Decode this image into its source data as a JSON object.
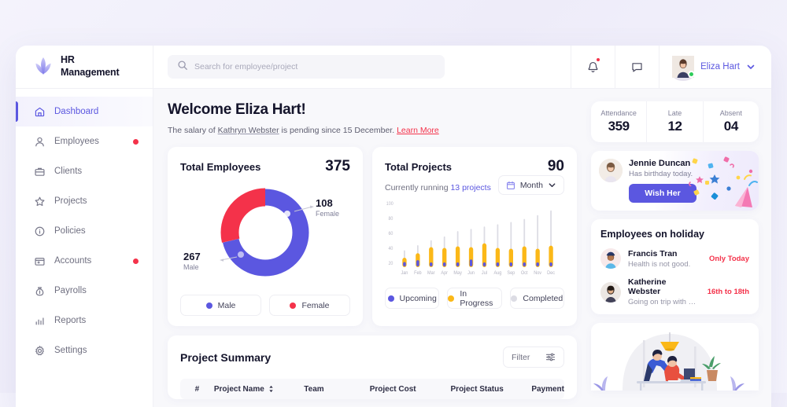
{
  "brand": {
    "line1": "HR",
    "line2": "Management",
    "logo_icon": "lotus-logo-icon"
  },
  "search": {
    "placeholder": "Search for employee/project",
    "value": "",
    "icon": "search-icon"
  },
  "header": {
    "bell_icon": "bell-icon",
    "chat_icon": "chat-bubble-icon",
    "user_name": "Eliza Hart",
    "chevron_icon": "chevron-down-icon"
  },
  "sidebar": {
    "items": [
      {
        "label": "Dashboard",
        "icon": "home-icon",
        "active": true,
        "badge": false
      },
      {
        "label": "Employees",
        "icon": "user-icon",
        "active": false,
        "badge": true
      },
      {
        "label": "Clients",
        "icon": "briefcase-icon",
        "active": false,
        "badge": false
      },
      {
        "label": "Projects",
        "icon": "star-icon",
        "active": false,
        "badge": false
      },
      {
        "label": "Policies",
        "icon": "info-icon",
        "active": false,
        "badge": false
      },
      {
        "label": "Accounts",
        "icon": "folder-icon",
        "active": false,
        "badge": true
      },
      {
        "label": "Payrolls",
        "icon": "money-bag-icon",
        "active": false,
        "badge": false
      },
      {
        "label": "Reports",
        "icon": "bar-chart-icon",
        "active": false,
        "badge": false
      },
      {
        "label": "Settings",
        "icon": "gear-icon",
        "active": false,
        "badge": false
      }
    ]
  },
  "welcome": {
    "heading": "Welcome Eliza Hart!",
    "sub_prefix": "The salary of ",
    "sub_person": "Kathryn Webster",
    "sub_middle": " is pending since 15 December. ",
    "sub_link": "Learn More"
  },
  "employees_card": {
    "title": "Total Employees",
    "total": "375",
    "male_value": "267",
    "male_label": "Male",
    "female_value": "108",
    "female_label": "Female",
    "legend": [
      {
        "label": "Male",
        "color": "#5b57e0"
      },
      {
        "label": "Female",
        "color": "#f4324a"
      }
    ]
  },
  "projects_card": {
    "title": "Total Projects",
    "total": "90",
    "sub_prefix": "Currently running ",
    "sub_link": "13 projects",
    "range_label": "Month",
    "calendar_icon": "calendar-icon",
    "chevron_icon": "chevron-down-icon",
    "legend": [
      {
        "label": "Upcoming",
        "color": "#5b57e0"
      },
      {
        "label": "In Progress",
        "color": "#fbb818"
      },
      {
        "label": "Completed",
        "color": "#dcdce4"
      }
    ]
  },
  "chart_data": [
    {
      "type": "pie",
      "title": "Total Employees",
      "labels": [
        "Male",
        "Female"
      ],
      "values": [
        267,
        108
      ],
      "colors": [
        "#5b57e0",
        "#f4324a"
      ],
      "total": 375,
      "donut": true
    },
    {
      "type": "bar",
      "title": "Total Projects",
      "stacked": true,
      "categories": [
        "Jan",
        "Feb",
        "Mar",
        "Apr",
        "May",
        "Jun",
        "Jul",
        "Aug",
        "Sep",
        "Oct",
        "Nov",
        "Dec"
      ],
      "series": [
        {
          "name": "Upcoming",
          "color": "#5b57e0",
          "values": [
            22,
            24,
            21,
            21,
            21,
            25,
            21,
            21,
            21,
            21,
            21,
            21
          ]
        },
        {
          "name": "In Progress",
          "color": "#fbb818",
          "values": [
            26,
            32,
            40,
            39,
            41,
            40,
            45,
            39,
            38,
            41,
            38,
            42
          ]
        },
        {
          "name": "Completed",
          "color": "#dcdce4",
          "values": [
            38,
            45,
            52,
            57,
            64,
            67,
            70,
            73,
            76,
            80,
            85,
            91
          ]
        }
      ],
      "ylim": [
        20,
        100
      ],
      "yticks": [
        20,
        40,
        60,
        80,
        100
      ],
      "ylabel": "",
      "xlabel": "",
      "grid": false,
      "legend_position": "bottom"
    }
  ],
  "stats": [
    {
      "label": "Attendance",
      "value": "359"
    },
    {
      "label": "Late",
      "value": "12"
    },
    {
      "label": "Absent",
      "value": "04"
    }
  ],
  "birthday": {
    "name": "Jennie Duncan",
    "note": "Has birthday today.",
    "button": "Wish Her"
  },
  "holiday": {
    "title": "Employees on holiday",
    "items": [
      {
        "name": "Francis Tran",
        "note": "Health is not good.",
        "when": "Only Today"
      },
      {
        "name": "Katherine Webster",
        "note": "Going on trip with my fam…",
        "when": "16th to 18th"
      }
    ]
  },
  "summary": {
    "title": "Project Summary",
    "filter_label": "Filter",
    "filter_icon": "sliders-icon",
    "columns": [
      "#",
      "Project Name",
      "Team",
      "Project Cost",
      "Project Status",
      "Payment"
    ],
    "sort_icon": "sort-arrows-icon"
  },
  "colors": {
    "accent": "#5b57e0",
    "danger": "#f4324a",
    "warning": "#fbb818",
    "muted": "#dcdce4",
    "page_bg": "#f2f1fb"
  }
}
